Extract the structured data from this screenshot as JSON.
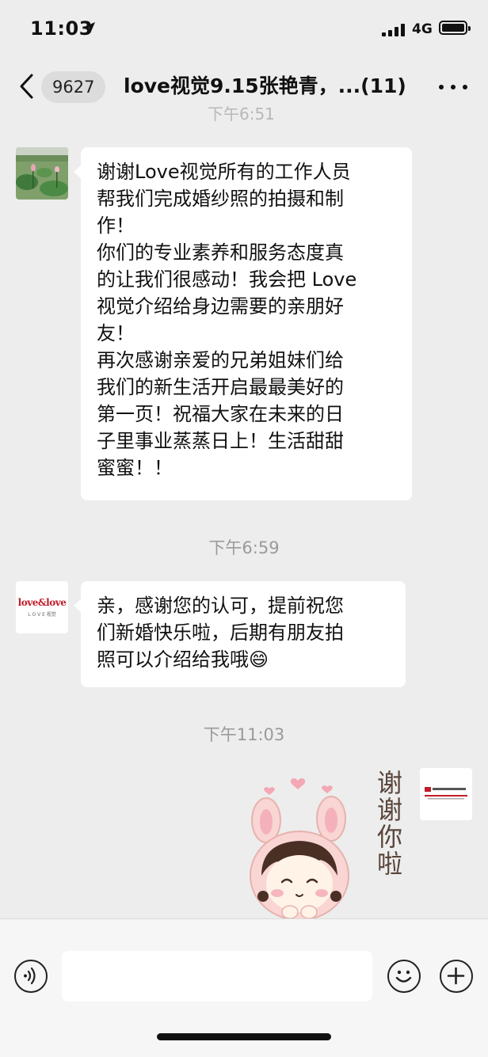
{
  "status_bar": {
    "time": "11:03",
    "network": "4G"
  },
  "nav": {
    "unread_count": "9627",
    "title": "love视觉9.15张艳青，...(11)"
  },
  "earlier_timestamp_partial": "下午6:51",
  "messages": [
    {
      "side": "left",
      "avatar": "lotus-photo",
      "text": "谢谢Love视觉所有的工作人员\n帮我们完成婚纱照的拍摄和制\n作！\n你们的专业素养和服务态度真\n的让我们很感动！我会把 Love\n视觉介绍给身边需要的亲朋好\n友！\n再次感谢亲爱的兄弟姐妹们给\n我们的新生活开启最最美好的\n第一页！祝福大家在未来的日\n子里事业蒸蒸日上！生活甜甜\n蜜蜜！！"
    },
    {
      "side": "left",
      "avatar": "love-and-love-logo",
      "logo_main": "love&love",
      "logo_sub": "L O V E  视觉",
      "text": "亲，感谢您的认可，提前祝您\n们新婚快乐啦，后期有朋友拍\n照可以介绍给我哦",
      "emoji": "😄"
    },
    {
      "side": "right",
      "avatar": "love-vision-logo",
      "sticker_text": "谢谢你啦"
    }
  ],
  "timestamps": [
    "下午6:59",
    "下午11:03"
  ],
  "input": {
    "value": "",
    "placeholder": ""
  },
  "icons": {
    "voice": "voice-icon",
    "emoji": "emoji-icon",
    "add": "plus-icon",
    "back": "chevron-left-icon",
    "more": "more-icon"
  },
  "colors": {
    "background": "#ededed",
    "bubble": "#ffffff",
    "logo_red": "#c01c28"
  }
}
